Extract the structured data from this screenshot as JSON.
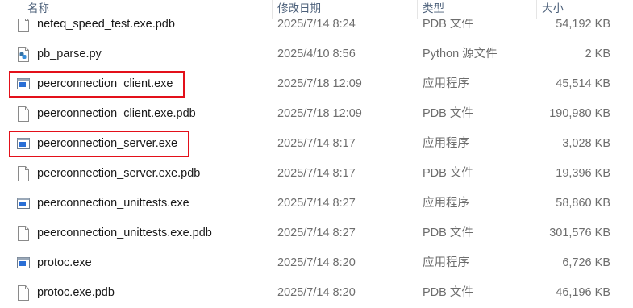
{
  "columns": {
    "name": "名称",
    "date": "修改日期",
    "type": "类型",
    "size": "大小"
  },
  "files": [
    {
      "name": "neteq_speed_test.exe.pdb",
      "date": "2025/7/14 8:24",
      "type": "PDB 文件",
      "size": "54,192 KB",
      "icon": "file-icon"
    },
    {
      "name": "pb_parse.py",
      "date": "2025/4/10 8:56",
      "type": "Python 源文件",
      "size": "2 KB",
      "icon": "python-file-icon"
    },
    {
      "name": "peerconnection_client.exe",
      "date": "2025/7/18 12:09",
      "type": "应用程序",
      "size": "45,514 KB",
      "icon": "exe-icon",
      "highlighted": true
    },
    {
      "name": "peerconnection_client.exe.pdb",
      "date": "2025/7/18 12:09",
      "type": "PDB 文件",
      "size": "190,980 KB",
      "icon": "file-icon"
    },
    {
      "name": "peerconnection_server.exe",
      "date": "2025/7/14 8:17",
      "type": "应用程序",
      "size": "3,028 KB",
      "icon": "exe-icon",
      "highlighted": true
    },
    {
      "name": "peerconnection_server.exe.pdb",
      "date": "2025/7/14 8:17",
      "type": "PDB 文件",
      "size": "19,396 KB",
      "icon": "file-icon"
    },
    {
      "name": "peerconnection_unittests.exe",
      "date": "2025/7/14 8:27",
      "type": "应用程序",
      "size": "58,860 KB",
      "icon": "exe-icon"
    },
    {
      "name": "peerconnection_unittests.exe.pdb",
      "date": "2025/7/14 8:27",
      "type": "PDB 文件",
      "size": "301,576 KB",
      "icon": "file-icon"
    },
    {
      "name": "protoc.exe",
      "date": "2025/7/14 8:20",
      "type": "应用程序",
      "size": "6,726 KB",
      "icon": "exe-icon"
    },
    {
      "name": "protoc.exe.pdb",
      "date": "2025/7/14 8:20",
      "type": "PDB 文件",
      "size": "46,196 KB",
      "icon": "file-icon"
    }
  ],
  "colors": {
    "highlight": "#e3101a",
    "header_text": "#4c607a",
    "secondary_text": "#6d6d6d",
    "exe_icon": "#2a6fd6"
  }
}
